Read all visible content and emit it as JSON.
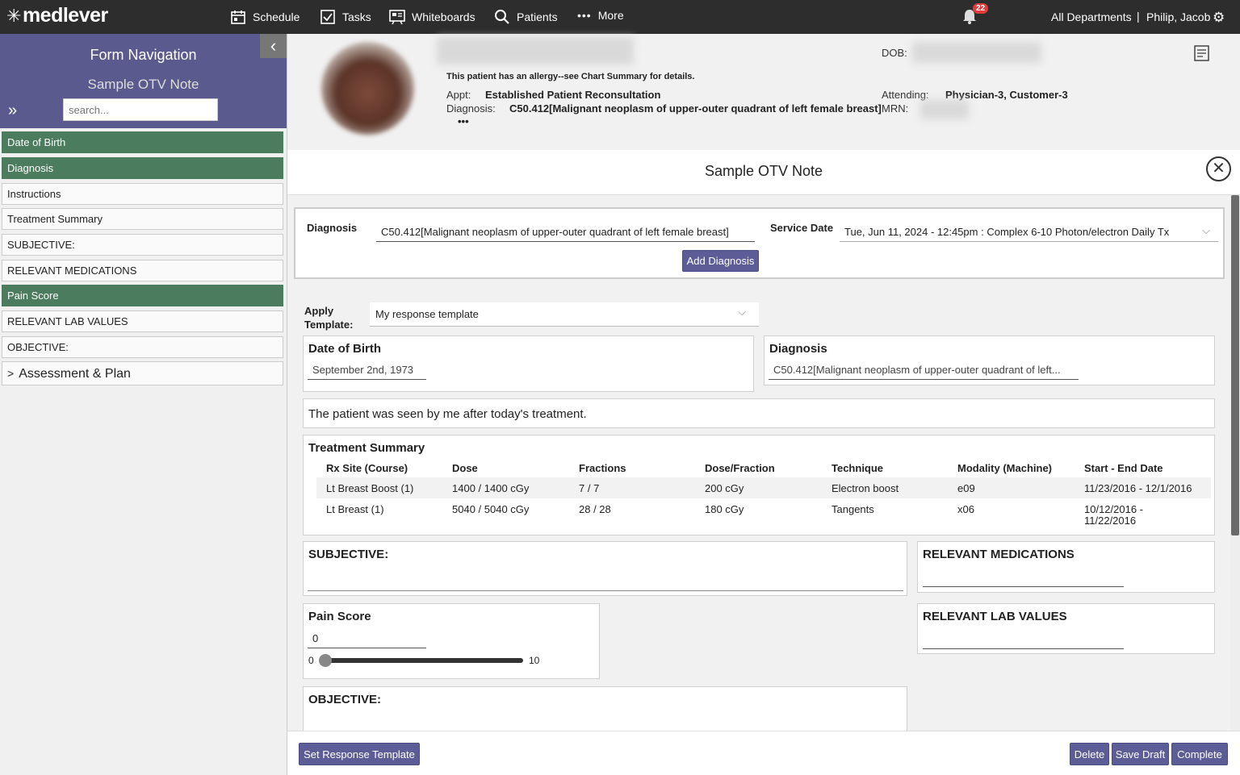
{
  "app": {
    "logo": "medlever"
  },
  "topnav": {
    "schedule": "Schedule",
    "tasks": "Tasks",
    "whiteboards": "Whiteboards",
    "patients": "Patients",
    "more": "More",
    "notification_count": "22",
    "departments": "All Departments",
    "separator": "|",
    "user": "Philip, Jacob"
  },
  "sidebar": {
    "title": "Form Navigation",
    "subtitle": "Sample OTV Note",
    "search_placeholder": "search...",
    "items": [
      {
        "label": "Date of Birth",
        "active": true
      },
      {
        "label": "Diagnosis",
        "active": true
      },
      {
        "label": "Instructions",
        "active": false
      },
      {
        "label": "Treatment Summary",
        "active": false
      },
      {
        "label": "SUBJECTIVE:",
        "active": false
      },
      {
        "label": "RELEVANT MEDICATIONS",
        "active": false
      },
      {
        "label": "Pain Score",
        "active": true
      },
      {
        "label": "RELEVANT LAB VALUES",
        "active": false
      },
      {
        "label": "OBJECTIVE:",
        "active": false
      },
      {
        "label": "Assessment & Plan",
        "active": false
      }
    ],
    "expand_chevron": ">"
  },
  "patient": {
    "dob_label": "DOB:",
    "allergy_notice": "This patient has an allergy--see Chart Summary for details.",
    "appt_label": "Appt:",
    "appt_value": "Established Patient Reconsultation",
    "diagnosis_label": "Diagnosis:",
    "diagnosis_value": "C50.412[Malignant neoplasm of upper-outer quadrant of left female breast]",
    "attending_label": "Attending:",
    "attending_value": "Physician-3, Customer-3",
    "mrn_label": "MRN:",
    "more_dots": "•••"
  },
  "form": {
    "title": "Sample OTV Note",
    "diagnosis_label": "Diagnosis",
    "diagnosis_value": "C50.412[Malignant neoplasm of upper-outer quadrant of left female breast]",
    "service_date_label": "Service Date",
    "service_date_value": "Tue, Jun 11, 2024 - 12:45pm : Complex 6-10 Photon/electron Daily Tx",
    "add_diagnosis": "Add Diagnosis",
    "apply_template_label": "Apply Template:",
    "apply_template_value": "My response template",
    "dob_section": {
      "title": "Date of Birth",
      "value": "September 2nd, 1973"
    },
    "diagnosis_section": {
      "title": "Diagnosis",
      "value": "C50.412[Malignant neoplasm of upper-outer quadrant of left..."
    },
    "instructions_text": "The patient was seen by me after today's treatment.",
    "treatment_summary": {
      "title": "Treatment Summary",
      "headers": [
        "Rx Site (Course)",
        "Dose",
        "Fractions",
        "Dose/Fraction",
        "Technique",
        "Modality (Machine)",
        "Start - End Date"
      ],
      "rows": [
        [
          "Lt Breast Boost (1)",
          "1400 / 1400 cGy",
          "7 / 7",
          "200 cGy",
          "Electron boost",
          "e09",
          "11/23/2016 - 12/1/2016"
        ],
        [
          "Lt Breast (1)",
          "5040 / 5040 cGy",
          "28 / 28",
          "180 cGy",
          "Tangents",
          "x06",
          "10/12/2016 -",
          "11/22/2016"
        ]
      ]
    },
    "subjective_title": "SUBJECTIVE:",
    "relevant_medications_title": "RELEVANT MEDICATIONS",
    "pain_score": {
      "title": "Pain Score",
      "value": "0",
      "min": "0",
      "max": "10",
      "level": 0
    },
    "relevant_lab_values_title": "RELEVANT LAB VALUES",
    "objective_title": "OBJECTIVE:"
  },
  "footer": {
    "set_response_template": "Set Response Template",
    "delete": "Delete",
    "save_draft": "Save Draft",
    "complete": "Complete"
  },
  "colors": {
    "topbar": "#2d2d2d",
    "sidebar_header": "#5a5a8e",
    "nav_active": "#4a7c5d",
    "button": "#5c5c96"
  }
}
